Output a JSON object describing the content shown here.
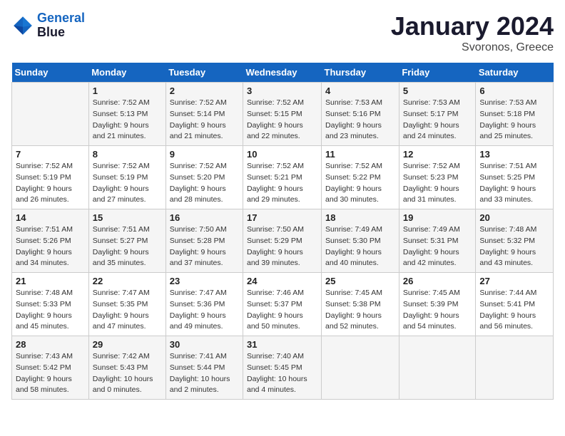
{
  "logo": {
    "line1": "General",
    "line2": "Blue"
  },
  "title": "January 2024",
  "subtitle": "Svoronos, Greece",
  "weekdays": [
    "Sunday",
    "Monday",
    "Tuesday",
    "Wednesday",
    "Thursday",
    "Friday",
    "Saturday"
  ],
  "weeks": [
    [
      {
        "day": "",
        "sunrise": "",
        "sunset": "",
        "daylight": ""
      },
      {
        "day": "1",
        "sunrise": "Sunrise: 7:52 AM",
        "sunset": "Sunset: 5:13 PM",
        "daylight": "Daylight: 9 hours and 21 minutes."
      },
      {
        "day": "2",
        "sunrise": "Sunrise: 7:52 AM",
        "sunset": "Sunset: 5:14 PM",
        "daylight": "Daylight: 9 hours and 21 minutes."
      },
      {
        "day": "3",
        "sunrise": "Sunrise: 7:52 AM",
        "sunset": "Sunset: 5:15 PM",
        "daylight": "Daylight: 9 hours and 22 minutes."
      },
      {
        "day": "4",
        "sunrise": "Sunrise: 7:53 AM",
        "sunset": "Sunset: 5:16 PM",
        "daylight": "Daylight: 9 hours and 23 minutes."
      },
      {
        "day": "5",
        "sunrise": "Sunrise: 7:53 AM",
        "sunset": "Sunset: 5:17 PM",
        "daylight": "Daylight: 9 hours and 24 minutes."
      },
      {
        "day": "6",
        "sunrise": "Sunrise: 7:53 AM",
        "sunset": "Sunset: 5:18 PM",
        "daylight": "Daylight: 9 hours and 25 minutes."
      }
    ],
    [
      {
        "day": "7",
        "sunrise": "Sunrise: 7:52 AM",
        "sunset": "Sunset: 5:19 PM",
        "daylight": "Daylight: 9 hours and 26 minutes."
      },
      {
        "day": "8",
        "sunrise": "Sunrise: 7:52 AM",
        "sunset": "Sunset: 5:19 PM",
        "daylight": "Daylight: 9 hours and 27 minutes."
      },
      {
        "day": "9",
        "sunrise": "Sunrise: 7:52 AM",
        "sunset": "Sunset: 5:20 PM",
        "daylight": "Daylight: 9 hours and 28 minutes."
      },
      {
        "day": "10",
        "sunrise": "Sunrise: 7:52 AM",
        "sunset": "Sunset: 5:21 PM",
        "daylight": "Daylight: 9 hours and 29 minutes."
      },
      {
        "day": "11",
        "sunrise": "Sunrise: 7:52 AM",
        "sunset": "Sunset: 5:22 PM",
        "daylight": "Daylight: 9 hours and 30 minutes."
      },
      {
        "day": "12",
        "sunrise": "Sunrise: 7:52 AM",
        "sunset": "Sunset: 5:23 PM",
        "daylight": "Daylight: 9 hours and 31 minutes."
      },
      {
        "day": "13",
        "sunrise": "Sunrise: 7:51 AM",
        "sunset": "Sunset: 5:25 PM",
        "daylight": "Daylight: 9 hours and 33 minutes."
      }
    ],
    [
      {
        "day": "14",
        "sunrise": "Sunrise: 7:51 AM",
        "sunset": "Sunset: 5:26 PM",
        "daylight": "Daylight: 9 hours and 34 minutes."
      },
      {
        "day": "15",
        "sunrise": "Sunrise: 7:51 AM",
        "sunset": "Sunset: 5:27 PM",
        "daylight": "Daylight: 9 hours and 35 minutes."
      },
      {
        "day": "16",
        "sunrise": "Sunrise: 7:50 AM",
        "sunset": "Sunset: 5:28 PM",
        "daylight": "Daylight: 9 hours and 37 minutes."
      },
      {
        "day": "17",
        "sunrise": "Sunrise: 7:50 AM",
        "sunset": "Sunset: 5:29 PM",
        "daylight": "Daylight: 9 hours and 39 minutes."
      },
      {
        "day": "18",
        "sunrise": "Sunrise: 7:49 AM",
        "sunset": "Sunset: 5:30 PM",
        "daylight": "Daylight: 9 hours and 40 minutes."
      },
      {
        "day": "19",
        "sunrise": "Sunrise: 7:49 AM",
        "sunset": "Sunset: 5:31 PM",
        "daylight": "Daylight: 9 hours and 42 minutes."
      },
      {
        "day": "20",
        "sunrise": "Sunrise: 7:48 AM",
        "sunset": "Sunset: 5:32 PM",
        "daylight": "Daylight: 9 hours and 43 minutes."
      }
    ],
    [
      {
        "day": "21",
        "sunrise": "Sunrise: 7:48 AM",
        "sunset": "Sunset: 5:33 PM",
        "daylight": "Daylight: 9 hours and 45 minutes."
      },
      {
        "day": "22",
        "sunrise": "Sunrise: 7:47 AM",
        "sunset": "Sunset: 5:35 PM",
        "daylight": "Daylight: 9 hours and 47 minutes."
      },
      {
        "day": "23",
        "sunrise": "Sunrise: 7:47 AM",
        "sunset": "Sunset: 5:36 PM",
        "daylight": "Daylight: 9 hours and 49 minutes."
      },
      {
        "day": "24",
        "sunrise": "Sunrise: 7:46 AM",
        "sunset": "Sunset: 5:37 PM",
        "daylight": "Daylight: 9 hours and 50 minutes."
      },
      {
        "day": "25",
        "sunrise": "Sunrise: 7:45 AM",
        "sunset": "Sunset: 5:38 PM",
        "daylight": "Daylight: 9 hours and 52 minutes."
      },
      {
        "day": "26",
        "sunrise": "Sunrise: 7:45 AM",
        "sunset": "Sunset: 5:39 PM",
        "daylight": "Daylight: 9 hours and 54 minutes."
      },
      {
        "day": "27",
        "sunrise": "Sunrise: 7:44 AM",
        "sunset": "Sunset: 5:41 PM",
        "daylight": "Daylight: 9 hours and 56 minutes."
      }
    ],
    [
      {
        "day": "28",
        "sunrise": "Sunrise: 7:43 AM",
        "sunset": "Sunset: 5:42 PM",
        "daylight": "Daylight: 9 hours and 58 minutes."
      },
      {
        "day": "29",
        "sunrise": "Sunrise: 7:42 AM",
        "sunset": "Sunset: 5:43 PM",
        "daylight": "Daylight: 10 hours and 0 minutes."
      },
      {
        "day": "30",
        "sunrise": "Sunrise: 7:41 AM",
        "sunset": "Sunset: 5:44 PM",
        "daylight": "Daylight: 10 hours and 2 minutes."
      },
      {
        "day": "31",
        "sunrise": "Sunrise: 7:40 AM",
        "sunset": "Sunset: 5:45 PM",
        "daylight": "Daylight: 10 hours and 4 minutes."
      },
      {
        "day": "",
        "sunrise": "",
        "sunset": "",
        "daylight": ""
      },
      {
        "day": "",
        "sunrise": "",
        "sunset": "",
        "daylight": ""
      },
      {
        "day": "",
        "sunrise": "",
        "sunset": "",
        "daylight": ""
      }
    ]
  ]
}
